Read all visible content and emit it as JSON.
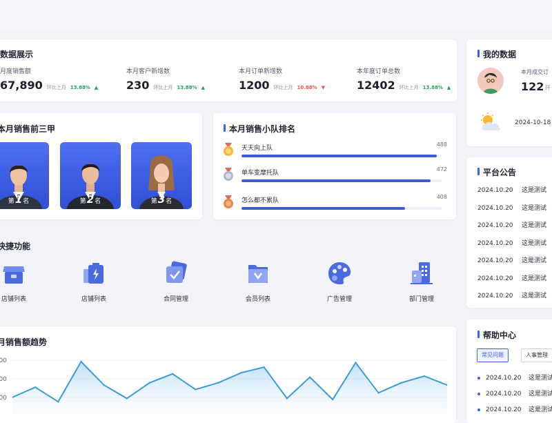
{
  "colors": {
    "accent": "#3d63dd",
    "up": "#25a35b",
    "down": "#e8534f",
    "bg": "#f2f4fa"
  },
  "data_display": {
    "title": "数据展示",
    "stats": [
      {
        "label": "月度销售额",
        "value": "67,890",
        "compare": "环比上月",
        "percent": "13.88%",
        "trend": "up"
      },
      {
        "label": "本月客户新增数",
        "value": "230",
        "compare": "环比上月",
        "percent": "13.88%",
        "trend": "up"
      },
      {
        "label": "本月订单新增数",
        "value": "1200",
        "compare": "环比上月",
        "percent": "10.88%",
        "trend": "down"
      },
      {
        "label": "本年度订单总数",
        "value": "12402",
        "compare": "环比上月",
        "percent": "13.88%",
        "trend": "up"
      }
    ]
  },
  "my_data": {
    "title": "我的数据",
    "label": "本月成交订",
    "value": "122",
    "trend_text": "环",
    "date": "2024-10-18",
    "weather_icon": "partly-cloudy-icon"
  },
  "top3": {
    "title": "本月销售前三甲",
    "people": [
      {
        "prefix": "第",
        "rank": "1",
        "suffix": "名"
      },
      {
        "prefix": "第",
        "rank": "2",
        "suffix": "名"
      },
      {
        "prefix": "第",
        "rank": "3",
        "suffix": "名"
      }
    ]
  },
  "team_ranking": {
    "title": "本月销售小队排名",
    "teams": [
      {
        "name": "天天向上队",
        "value": 488,
        "medal": "gold-medal-icon"
      },
      {
        "name": "单车变摩托队",
        "value": 472,
        "medal": "silver-medal-icon"
      },
      {
        "name": "怎么都不累队",
        "value": 408,
        "medal": "bronze-medal-icon"
      }
    ]
  },
  "quick": {
    "title": "快捷功能",
    "items": [
      {
        "label": "店铺列表",
        "icon": "store-icon"
      },
      {
        "label": "店铺列表",
        "icon": "battery-clipboard-icon"
      },
      {
        "label": "合同管理",
        "icon": "contract-check-icon"
      },
      {
        "label": "会员列表",
        "icon": "member-folder-icon"
      },
      {
        "label": "广告管理",
        "icon": "palette-icon"
      },
      {
        "label": "部门管理",
        "icon": "building-icon"
      }
    ]
  },
  "notices": {
    "title": "平台公告",
    "items": [
      {
        "date": "2024.10.20",
        "text": "这是测试"
      },
      {
        "date": "2024.10.20",
        "text": "这是测试"
      },
      {
        "date": "2024.10.20",
        "text": "这是测试"
      },
      {
        "date": "2024.10.20",
        "text": "这是测试"
      },
      {
        "date": "2024.10.20",
        "text": "这是测试"
      },
      {
        "date": "2024.10.20",
        "text": "这是测试"
      },
      {
        "date": "2024.10.20",
        "text": "这是测试"
      }
    ]
  },
  "help": {
    "title": "帮助中心",
    "tabs": [
      {
        "label": "常见问题",
        "active": true
      },
      {
        "label": "人事管理",
        "active": false
      }
    ],
    "items": [
      {
        "date": "2024.10.20",
        "text": "这是测试"
      },
      {
        "date": "2024.10.20",
        "text": "这是测试"
      },
      {
        "date": "2024.10.20",
        "text": "这是测试"
      }
    ]
  },
  "sales_trend": {
    "title": "月销售额趋势",
    "y_ticks": [
      "4000",
      "3000",
      "2000"
    ]
  },
  "chart_data": {
    "type": "area",
    "title": "月销售额趋势",
    "y_ticks": [
      4000,
      3000,
      2000
    ],
    "ylim": [
      0,
      4700
    ],
    "values": [
      1500,
      2400,
      1100,
      4700,
      2600,
      1400,
      2800,
      3600,
      2200,
      2800,
      3700,
      4200,
      1400,
      3300,
      1300,
      4600,
      1900,
      2800,
      3400,
      2600
    ]
  }
}
